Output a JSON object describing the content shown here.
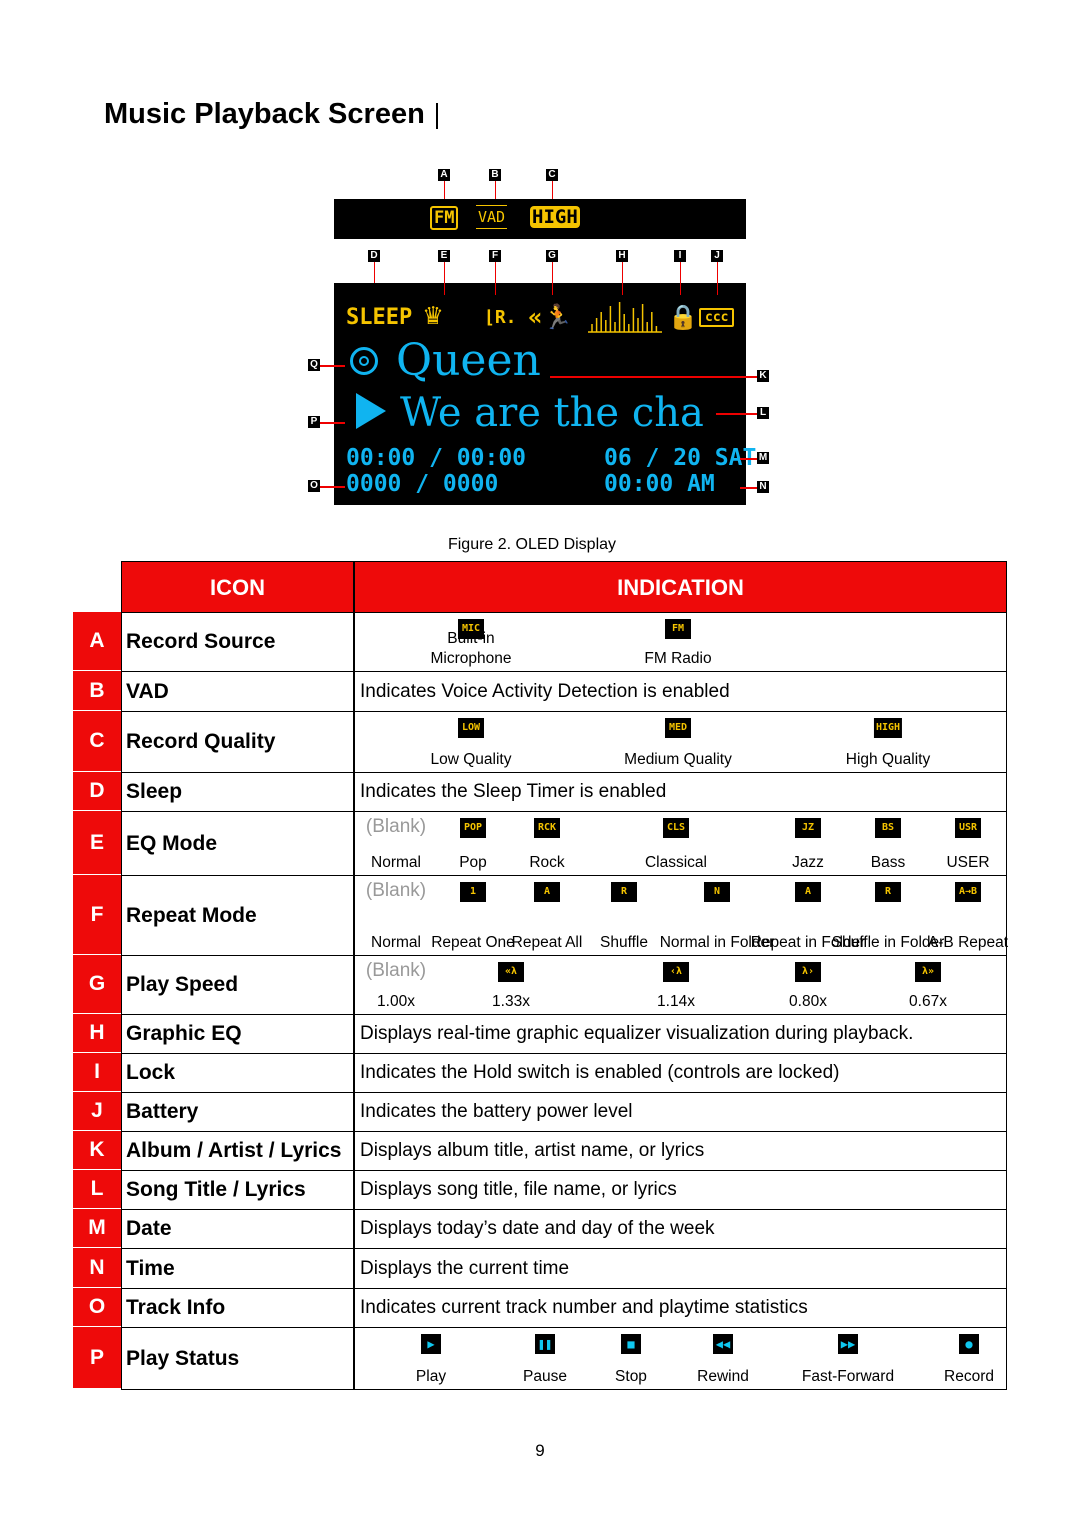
{
  "title": "Music Playback Screen",
  "figure": {
    "caption": "Figure 2. OLED Display",
    "top_bar": {
      "record_source": "FM",
      "vad": "VAD",
      "quality": "HIGH"
    },
    "status": {
      "sleep": "SLEEP",
      "lock_icon": "lock-icon",
      "battery_icon": "battery-icon",
      "eq_icon": "pop-eq-icon",
      "repeat_icon": "shuffle-icon",
      "speed_icon": "speed-icon",
      "graphic_eq_icon": "equalizer-bars-icon"
    },
    "artist": "Queen",
    "song": "We are the cha",
    "time": "00:00 / 00:00",
    "track": "0000 / 0000",
    "date": "06 / 20 SAT",
    "clock": "00:00 AM",
    "oled_colors": {
      "icons": "#f5c400",
      "text": "#10b4f0"
    },
    "tags": [
      "A",
      "B",
      "C",
      "D",
      "E",
      "F",
      "G",
      "H",
      "I",
      "J",
      "K",
      "L",
      "M",
      "N",
      "O",
      "P",
      "Q"
    ]
  },
  "table": {
    "headers": {
      "icon": "ICON",
      "indication": "INDICATION"
    },
    "header_color": "#ee0a0a",
    "rows": [
      {
        "letter": "A",
        "name": "Record Source",
        "items": [
          {
            "icon": "MIC",
            "label": "Built-in Microphone"
          },
          {
            "icon": "FM",
            "label": "FM Radio"
          }
        ]
      },
      {
        "letter": "B",
        "name": "VAD",
        "text": "Indicates Voice Activity Detection is enabled"
      },
      {
        "letter": "C",
        "name": "Record Quality",
        "items": [
          {
            "icon": "LOW",
            "label": "Low Quality"
          },
          {
            "icon": "MED",
            "label": "Medium Quality"
          },
          {
            "icon": "HIGH",
            "label": "High Quality"
          }
        ]
      },
      {
        "letter": "D",
        "name": "Sleep",
        "text": "Indicates the Sleep Timer is enabled"
      },
      {
        "letter": "E",
        "name": "EQ Mode",
        "items": [
          {
            "blank": "(Blank)",
            "label": "Normal"
          },
          {
            "icon": "POP",
            "label": "Pop"
          },
          {
            "icon": "RCK",
            "label": "Rock"
          },
          {
            "icon": "CLS",
            "label": "Classical"
          },
          {
            "icon": "JZ",
            "label": "Jazz"
          },
          {
            "icon": "BS",
            "label": "Bass"
          },
          {
            "icon": "USR",
            "label": "USER"
          }
        ]
      },
      {
        "letter": "F",
        "name": "Repeat Mode",
        "items": [
          {
            "blank": "(Blank)",
            "label": "Normal"
          },
          {
            "icon": "1",
            "label": "Repeat One"
          },
          {
            "icon": "A",
            "label": "Repeat All"
          },
          {
            "icon": "R",
            "label": "Shuffle"
          },
          {
            "icon": "N",
            "label": "Normal in Folder"
          },
          {
            "icon": "A",
            "label": "Repeat in Folder"
          },
          {
            "icon": "R",
            "label": "Shuffle in Folder"
          },
          {
            "icon": "A→B",
            "label": "A-B Repeat"
          }
        ]
      },
      {
        "letter": "G",
        "name": "Play Speed",
        "items": [
          {
            "blank": "(Blank)",
            "label": "1.00x"
          },
          {
            "icon": "«λ",
            "label": "1.33x"
          },
          {
            "icon": "‹λ",
            "label": "1.14x"
          },
          {
            "icon": "λ›",
            "label": "0.80x"
          },
          {
            "icon": "λ»",
            "label": "0.67x"
          }
        ]
      },
      {
        "letter": "H",
        "name": "Graphic EQ",
        "text": "Displays real-time graphic equalizer visualization during playback."
      },
      {
        "letter": "I",
        "name": "Lock",
        "text": "Indicates the Hold switch is enabled (controls are locked)"
      },
      {
        "letter": "J",
        "name": "Battery",
        "text": "Indicates the battery power level"
      },
      {
        "letter": "K",
        "name": "Album / Artist / Lyrics",
        "text": "Displays album title, artist name, or lyrics"
      },
      {
        "letter": "L",
        "name": "Song Title / Lyrics",
        "text": "Displays song title, file name, or lyrics"
      },
      {
        "letter": "M",
        "name": "Date",
        "text": "Displays today’s date and day of the week"
      },
      {
        "letter": "N",
        "name": "Time",
        "text": "Displays the current time"
      },
      {
        "letter": "O",
        "name": "Track Info",
        "text": "Indicates current track number and playtime statistics"
      },
      {
        "letter": "P",
        "name": "Play Status",
        "items": [
          {
            "icon": "▶",
            "cyan": true,
            "label": "Play"
          },
          {
            "icon": "❚❚",
            "cyan": true,
            "label": "Pause"
          },
          {
            "icon": "■",
            "cyan": true,
            "label": "Stop"
          },
          {
            "icon": "◀◀",
            "cyan": true,
            "label": "Rewind"
          },
          {
            "icon": "▶▶",
            "cyan": true,
            "label": "Fast-Forward"
          },
          {
            "icon": "●",
            "cyan": true,
            "label": "Record"
          }
        ]
      }
    ]
  },
  "page_number": "9"
}
